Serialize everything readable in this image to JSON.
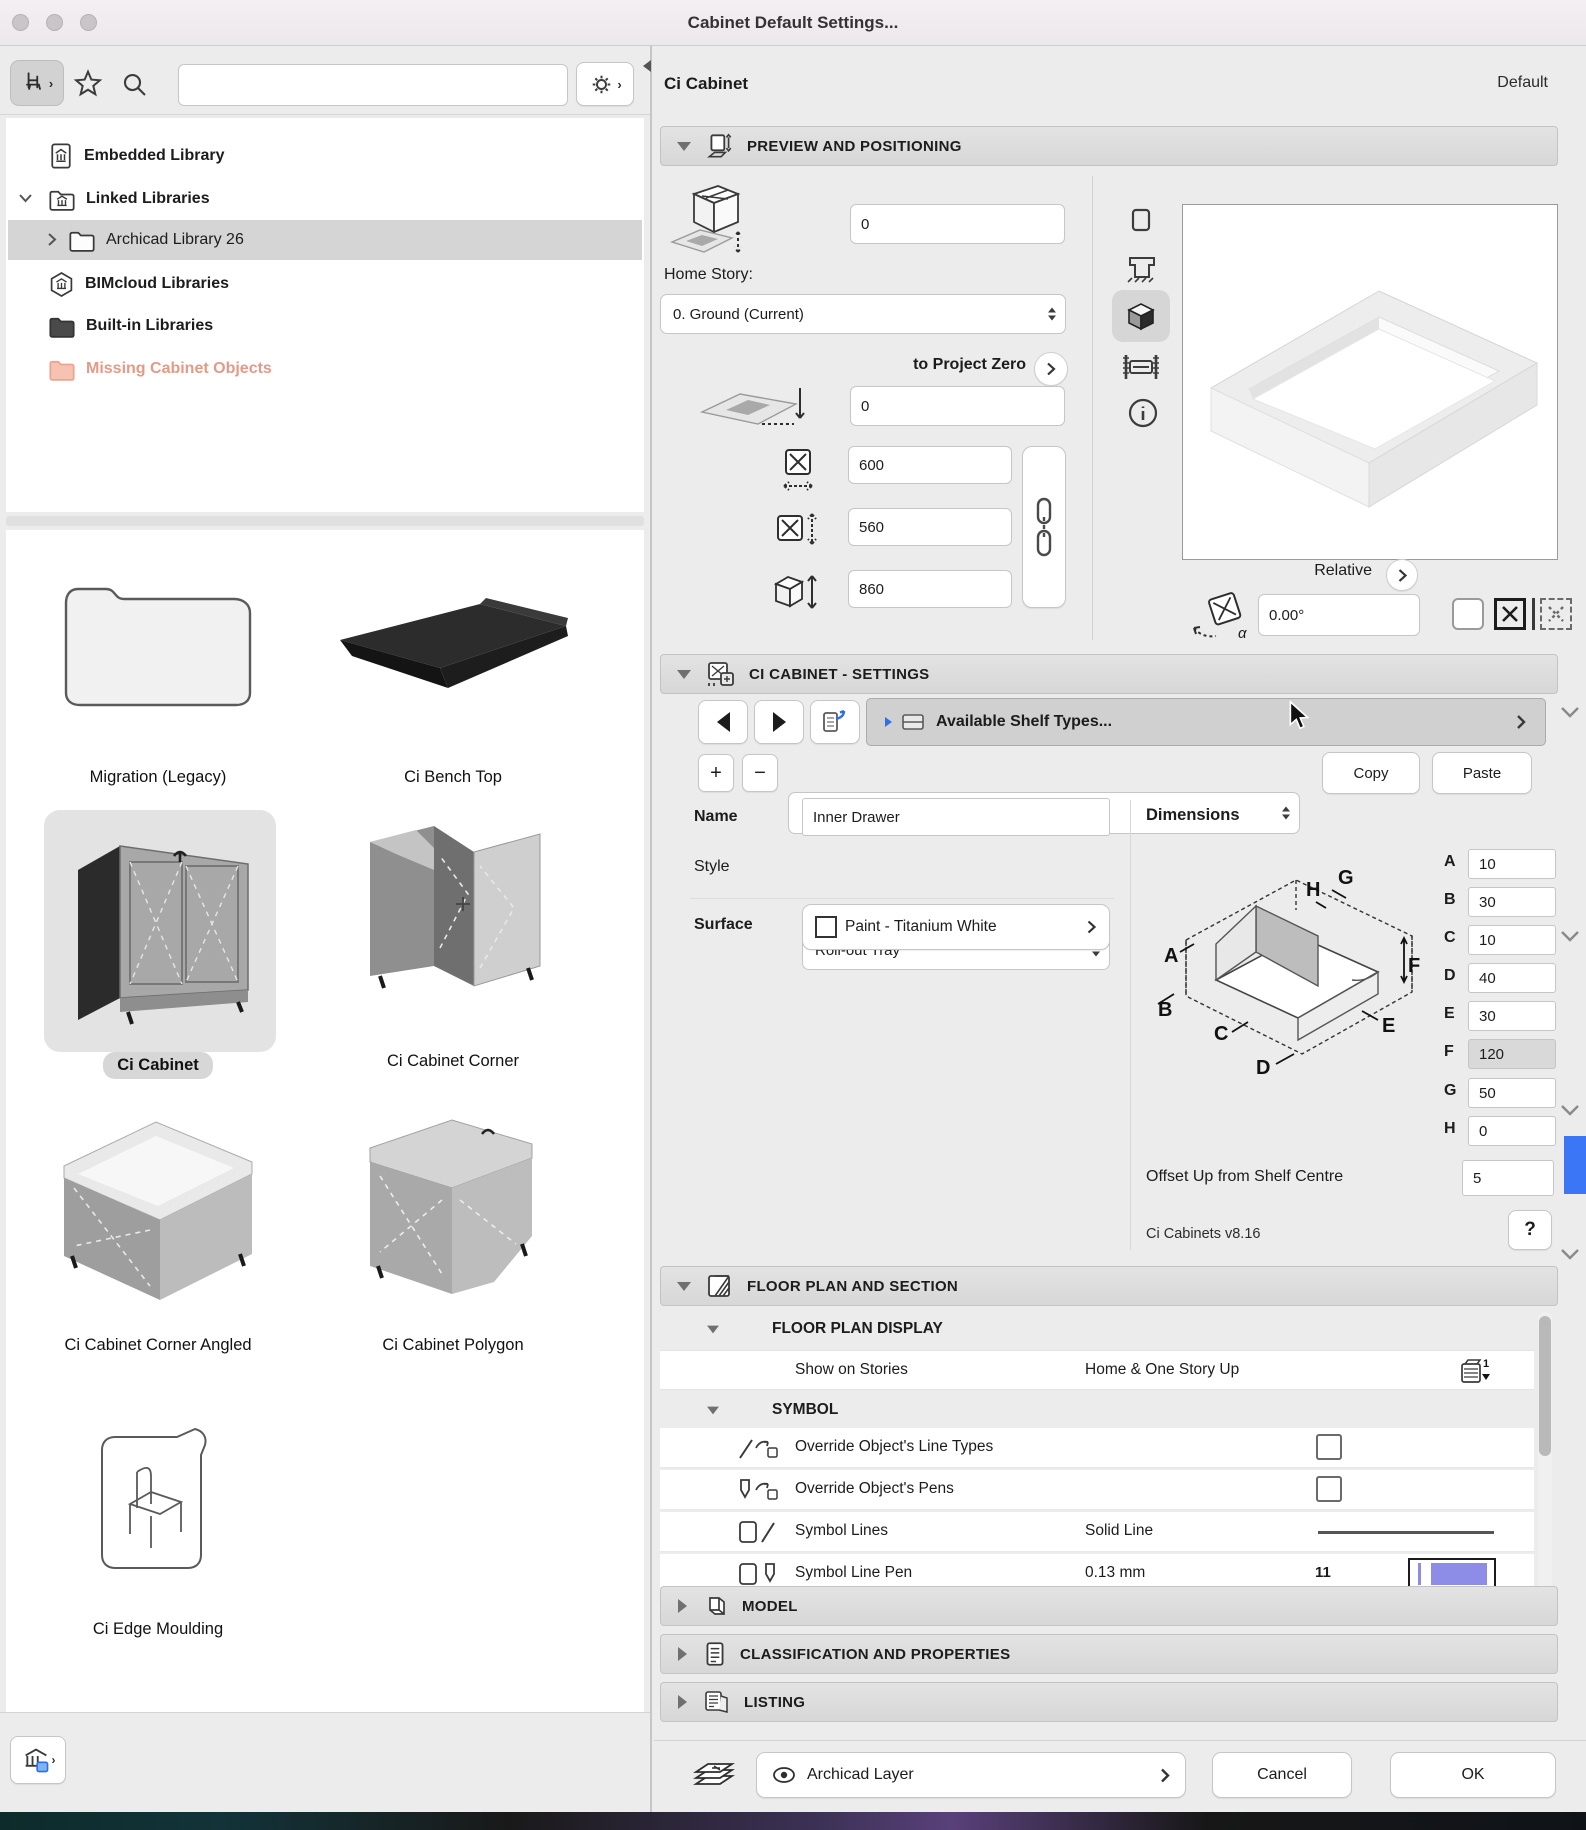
{
  "window": {
    "title": "Cabinet Default Settings..."
  },
  "left_panel": {
    "toolbar": {
      "search_value": ""
    },
    "tree": [
      {
        "label": "Embedded Library"
      },
      {
        "label": "Linked Libraries"
      },
      {
        "label": "Archicad Library 26"
      },
      {
        "label": "BIMcloud Libraries"
      },
      {
        "label": "Built-in Libraries"
      },
      {
        "label": "Missing Cabinet Objects"
      }
    ],
    "thumbnails": [
      {
        "label": "Migration (Legacy)"
      },
      {
        "label": "Ci Bench Top"
      },
      {
        "label": "Ci Cabinet"
      },
      {
        "label": "Ci Cabinet Corner"
      },
      {
        "label": "Ci Cabinet Corner Angled"
      },
      {
        "label": "Ci Cabinet Polygon"
      },
      {
        "label": "Ci Edge Moulding"
      }
    ]
  },
  "right_panel": {
    "header": {
      "title": "Ci Cabinet",
      "status": "Default"
    },
    "preview": {
      "section_title": "PREVIEW AND POSITIONING",
      "top_offset": "0",
      "home_story_label": "Home Story:",
      "home_story_value": "0. Ground (Current)",
      "to_project_zero_label": "to Project Zero",
      "bottom_offset": "0",
      "width": "600",
      "depth": "560",
      "height": "860",
      "relative_label": "Relative",
      "rotation_angle": "0.00°"
    },
    "settings": {
      "section_title": "CI CABINET - SETTINGS",
      "page_title": "Available Shelf Types...",
      "item_value": "Inner Drawer",
      "add_label": "+",
      "remove_label": "−",
      "copy_label": "Copy",
      "paste_label": "Paste",
      "name_label": "Name",
      "name_value": "Inner Drawer",
      "style_label": "Style",
      "style_value": "Roll-out Tray",
      "surface_label": "Surface",
      "surface_value": "Paint - Titanium White",
      "dimensions_label": "Dimensions",
      "dims": [
        {
          "label": "A",
          "value": "10"
        },
        {
          "label": "B",
          "value": "30"
        },
        {
          "label": "C",
          "value": "10"
        },
        {
          "label": "D",
          "value": "40"
        },
        {
          "label": "E",
          "value": "30"
        },
        {
          "label": "F",
          "value": "120"
        },
        {
          "label": "G",
          "value": "50"
        },
        {
          "label": "H",
          "value": "0"
        }
      ],
      "offset_label": "Offset Up from Shelf Centre",
      "offset_value": "5",
      "version": "Ci Cabinets v8.16",
      "help_label": "?"
    },
    "floor_plan": {
      "section_title": "FLOOR PLAN AND SECTION",
      "display_header": "FLOOR PLAN DISPLAY",
      "stories_label": "Show on Stories",
      "stories_value": "Home & One Story Up",
      "symbol_header": "SYMBOL",
      "rows": [
        {
          "label": "Override Object's Line Types"
        },
        {
          "label": "Override Object's Pens"
        },
        {
          "label": "Symbol Lines",
          "value": "Solid Line"
        },
        {
          "label": "Symbol Line Pen",
          "value": "0.13 mm",
          "pen_number": "11"
        }
      ]
    },
    "collapsed_sections": [
      {
        "label": "MODEL"
      },
      {
        "label": "CLASSIFICATION AND PROPERTIES"
      },
      {
        "label": "LISTING"
      }
    ],
    "footer": {
      "layer_value": "Archicad Layer",
      "cancel_label": "Cancel",
      "ok_label": "OK"
    }
  },
  "colors": {
    "scrollbar_blue": "#3b76f6",
    "pen_swatch": "#8d8de7",
    "missing_text": "#e59a86",
    "transfer_arrow": "#2f6fe4"
  }
}
